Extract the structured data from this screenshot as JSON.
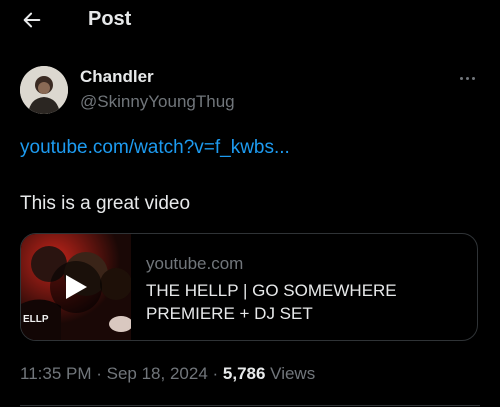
{
  "header": {
    "title": "Post",
    "back_icon": "arrow-left-icon"
  },
  "author": {
    "name": "Chandler",
    "handle": "@SkinnyYoungThug",
    "more_icon": "more-horizontal-icon"
  },
  "tweet": {
    "link_text": "youtube.com/watch?v=f_kwbs...",
    "text": "This is a great video"
  },
  "card": {
    "domain": "youtube.com",
    "title": "THE HELLP | GO SOMEWHERE PREMIERE + DJ SET",
    "thumb_text": "ELLP",
    "play_icon": "play-icon"
  },
  "meta": {
    "time": "11:35 PM",
    "separator": " · ",
    "date": "Sep 18, 2024",
    "views_count": "5,786",
    "views_label": "Views"
  },
  "colors": {
    "background": "#000000",
    "text": "#e7e9ea",
    "secondary": "#71767b",
    "link": "#1d9bf0",
    "border": "#2f3336"
  }
}
